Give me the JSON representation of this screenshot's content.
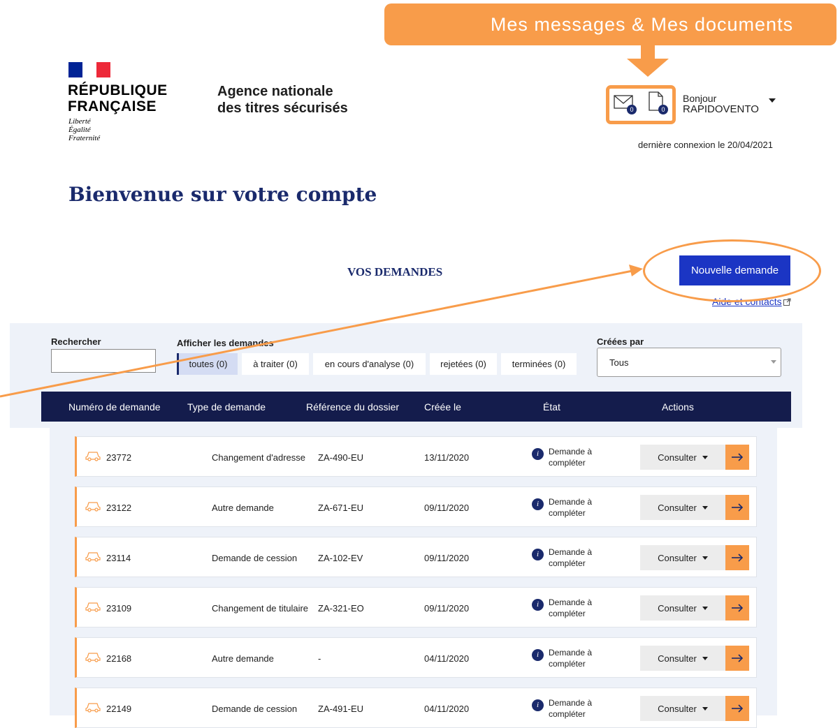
{
  "callout": {
    "text": "Mes messages & Mes  documents"
  },
  "logo": {
    "line1": "RÉPUBLIQUE",
    "line2": "FRANÇAISE",
    "motto": [
      "Liberté",
      "Égalité",
      "Fraternité"
    ]
  },
  "agency": {
    "line1": "Agence nationale",
    "line2": "des titres sécurisés"
  },
  "header": {
    "messages_count": "0",
    "documents_count": "0",
    "greeting": "Bonjour",
    "username": "RAPIDOVENTO",
    "last_login": "dernière connexion le 20/04/2021"
  },
  "page": {
    "welcome": "Bienvenue sur votre compte",
    "section_title": "VOS DEMANDES",
    "new_request_label": "Nouvelle demande",
    "help_label": "Aide et contacts"
  },
  "filters": {
    "search_label": "Rechercher",
    "search_value": "",
    "show_label": "Afficher les demandes",
    "tabs": [
      "toutes (0)",
      "à traiter (0)",
      "en cours d'analyse (0)",
      "rejetées (0)",
      "terminées (0)"
    ],
    "created_by_label": "Créées par",
    "created_by_value": "Tous"
  },
  "table": {
    "columns": [
      "Numéro de demande",
      "Type de demande",
      "Référence du dossier",
      "Créée le",
      "État",
      "Actions"
    ],
    "rows": [
      {
        "number": "23772",
        "type": "Changement d'adresse",
        "reference": "ZA-490-EU",
        "date": "13/11/2020",
        "state": "Demande à compléter",
        "action": "Consulter"
      },
      {
        "number": "23122",
        "type": "Autre demande",
        "reference": "ZA-671-EU",
        "date": "09/11/2020",
        "state": "Demande à compléter",
        "action": "Consulter"
      },
      {
        "number": "23114",
        "type": "Demande de cession",
        "reference": "ZA-102-EV",
        "date": "09/11/2020",
        "state": "Demande à compléter",
        "action": "Consulter"
      },
      {
        "number": "23109",
        "type": "Changement de titulaire",
        "reference": "ZA-321-EO",
        "date": "09/11/2020",
        "state": "Demande à compléter",
        "action": "Consulter"
      },
      {
        "number": "22168",
        "type": "Autre demande",
        "reference": "-",
        "date": "04/11/2020",
        "state": "Demande à compléter",
        "action": "Consulter"
      },
      {
        "number": "22149",
        "type": "Demande de cession",
        "reference": "ZA-491-EU",
        "date": "04/11/2020",
        "state": "Demande à compléter",
        "action": "Consulter"
      }
    ]
  },
  "colors": {
    "accent_orange": "#f89c4a",
    "navy": "#141c4c",
    "primary_blue": "#1b35c4",
    "panel_bg": "#eef2f9"
  }
}
